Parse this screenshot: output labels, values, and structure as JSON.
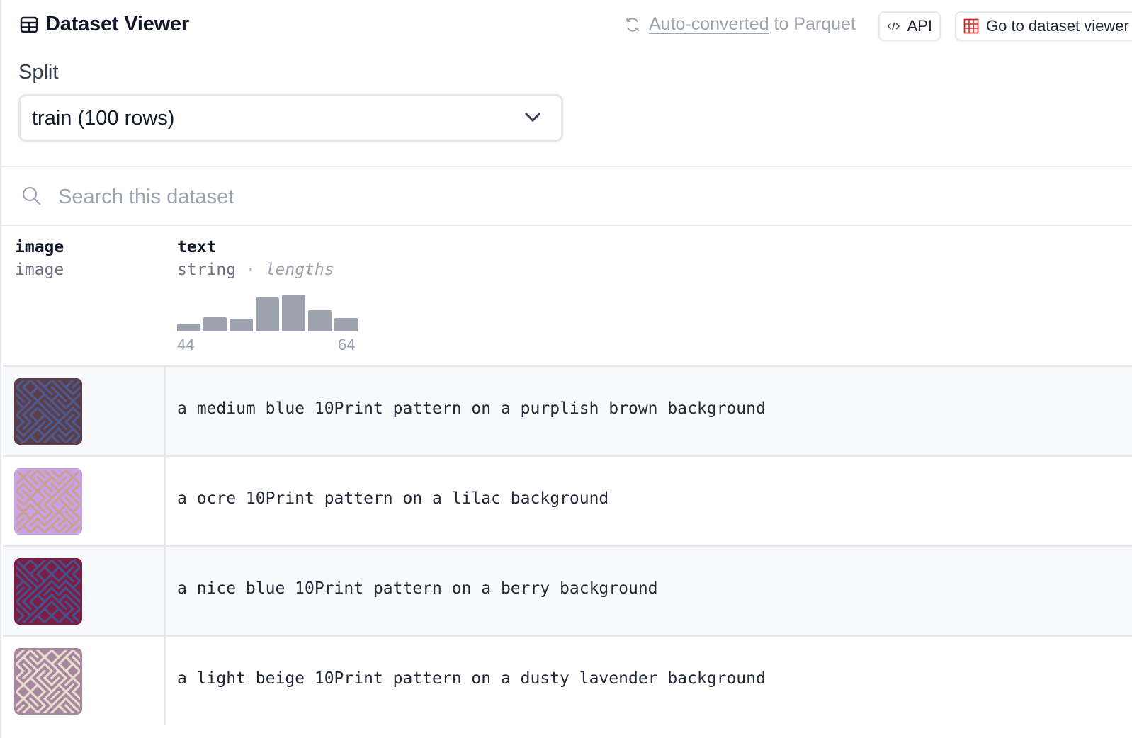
{
  "header": {
    "title": "Dataset Viewer",
    "parquet_link": "Auto-converted",
    "parquet_suffix": "to Parquet",
    "api_label": "API",
    "goto_label": "Go to dataset viewer"
  },
  "split": {
    "label": "Split",
    "selected": "train (100 rows)"
  },
  "search": {
    "placeholder": "Search this dataset"
  },
  "columns": [
    {
      "name": "image",
      "type": "image"
    },
    {
      "name": "text",
      "type": "string",
      "stat_sep": "·",
      "stat_label": "lengths"
    }
  ],
  "histogram": {
    "min_label": "44",
    "max_label": "64",
    "bins": [
      0.22,
      0.38,
      0.34,
      0.92,
      1.0,
      0.58,
      0.37
    ]
  },
  "rows": [
    {
      "text": "a medium blue 10Print pattern on a purplish brown background",
      "fg": "#4e5a8e",
      "bg": "#5a3f4a"
    },
    {
      "text": "a ocre 10Print pattern on a lilac background",
      "fg": "#caa08c",
      "bg": "#c8a2e6"
    },
    {
      "text": "a nice blue 10Print pattern on a berry background",
      "fg": "#45518a",
      "bg": "#7c1e43"
    },
    {
      "text": "a light beige 10Print pattern on a dusty lavender background",
      "fg": "#eadccc",
      "bg": "#a787a0"
    }
  ],
  "colors": {
    "accent_grid_icon": "#dc2626",
    "border": "#e5e7eb",
    "muted_text": "#9ca3af"
  }
}
